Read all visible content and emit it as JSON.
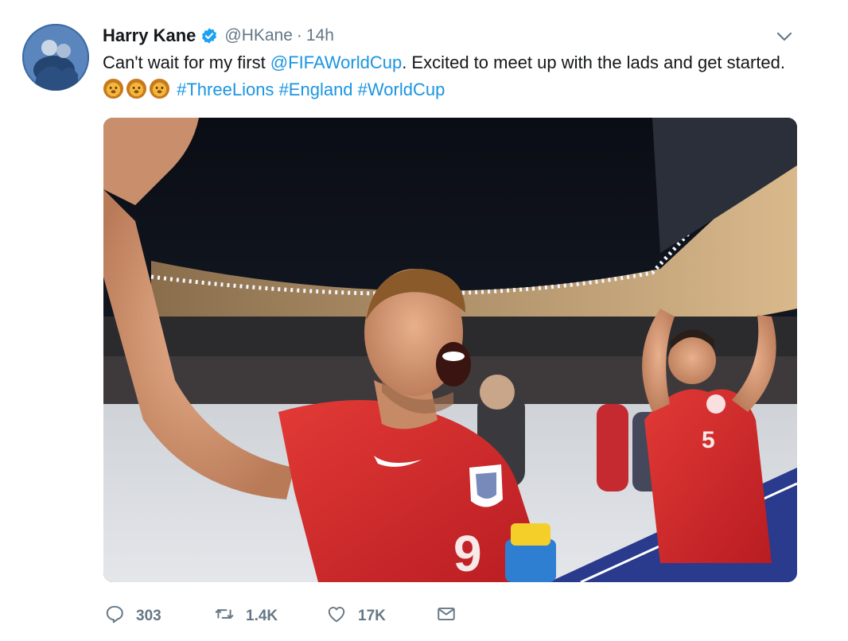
{
  "author": {
    "name": "Harry Kane",
    "handle": "@HKane",
    "separator": "·",
    "time": "14h",
    "verified": true
  },
  "tweet": {
    "text_before_mention": "Can't wait for my first ",
    "mention": "@FIFAWorldCup",
    "text_after_mention": ". Excited to meet up with the lads and get started.",
    "emoji": [
      "lion-face",
      "lion-face",
      "lion-face"
    ],
    "hashtags": [
      "#ThreeLions",
      "#England",
      "#WorldCup"
    ]
  },
  "actions": {
    "reply_count": "303",
    "retweet_count": "1.4K",
    "like_count": "17K"
  },
  "colors": {
    "link": "#1b95e0",
    "secondary_text": "#657786",
    "verified_badge": "#1da1f2",
    "england_kit_red": "#d8262a"
  },
  "icons": [
    "verified-icon",
    "chevron-down-icon",
    "reply-icon",
    "retweet-icon",
    "heart-icon",
    "envelope-icon"
  ]
}
